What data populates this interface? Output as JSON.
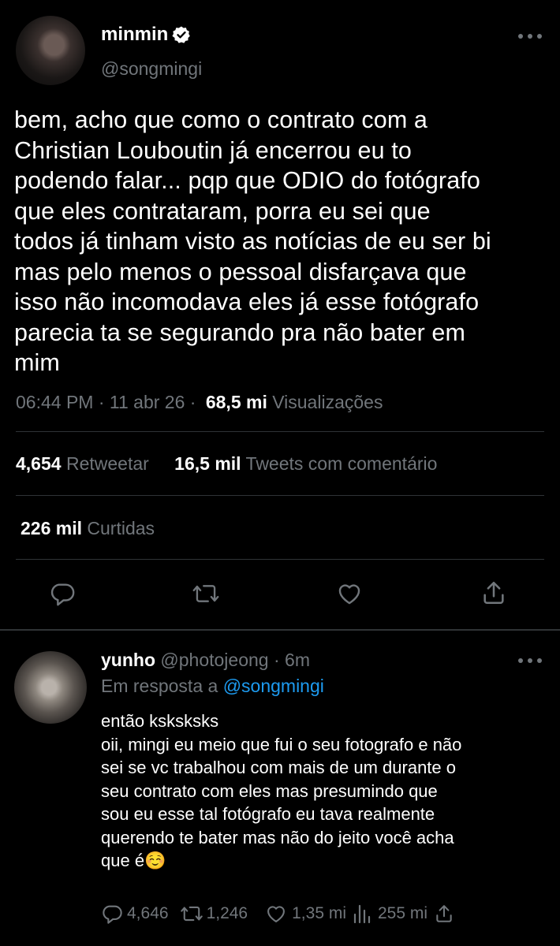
{
  "tweet": {
    "author_name": "minmin",
    "author_handle": "@songmingi",
    "text_lines": [
      "bem, acho que como o contrato com a",
      "Christian Louboutin já encerrou eu to",
      "podendo falar... pqp que ODIO do fotógrafo",
      "que eles contrataram, porra eu sei que",
      "todos já tinham visto as notícias de eu ser bi",
      "mas pelo menos o pessoal disfarçava que",
      "isso não incomodava eles já esse fotógrafo",
      "parecia ta se segurando pra não bater em",
      "mim"
    ],
    "time": "06:44 PM",
    "date": "11 abr 26",
    "views_count": "68,5 mi",
    "views_label": "Visualizações",
    "retweets_count": "4,654",
    "retweets_label": "Retweetar",
    "quotes_count": "16,5 mil",
    "quotes_label": "Tweets com comentário",
    "likes_count": "226 mil",
    "likes_label": "Curtidas"
  },
  "reply": {
    "author_name": "yunho",
    "author_handle": "@photojeong",
    "time": "6m",
    "replying_prefix": "Em resposta a",
    "replying_to": "@songmingi",
    "text_lines": [
      "então ksksksks",
      "oii, mingi eu meio que fui o seu fotografo e não",
      "sei se vc trabalhou com mais de um durante o",
      "seu contrato com eles mas presumindo que",
      "sou eu esse tal fotógrafo eu tava realmente",
      "querendo te bater mas não do jeito você acha",
      "que é☺️"
    ],
    "stats": {
      "replies": "4,646",
      "retweets": "1,246",
      "likes": "1,35 mi",
      "views": "255 mi"
    }
  },
  "colors": {
    "accent": "#1d9bf0",
    "background": "#000000",
    "muted": "#71767b",
    "text": "#e7e9ea",
    "verified": "#ffffff"
  },
  "icons": [
    "verified-badge-icon",
    "more-options-icon",
    "reply-icon",
    "retweet-icon",
    "like-icon",
    "share-icon",
    "views-icon"
  ]
}
